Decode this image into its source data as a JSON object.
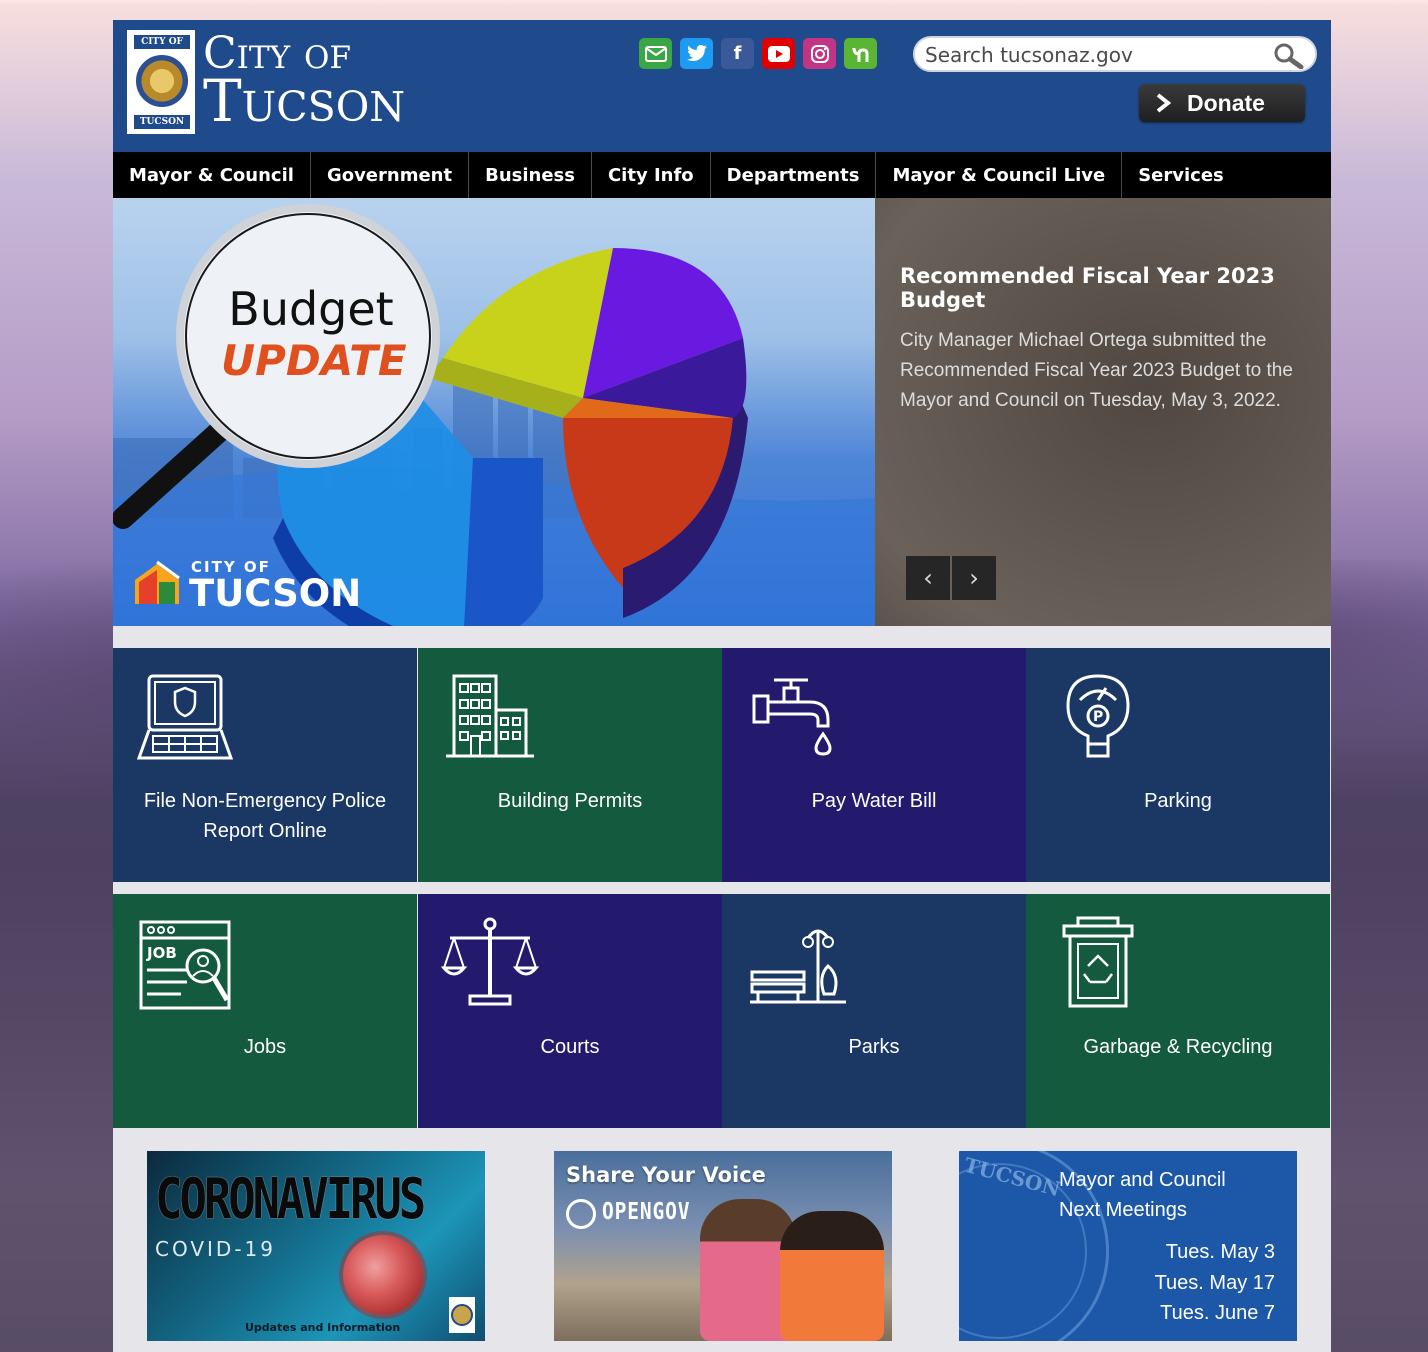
{
  "header": {
    "logo_top": "CITY OF",
    "logo_bottom": "TUCSON",
    "title_line1": "City of",
    "title_line2": "Tucson",
    "search_placeholder": "Search tucsonaz.gov",
    "donate_label": "Donate",
    "social": [
      {
        "name": "email-icon",
        "color": "#3aa646",
        "glyph": "✉"
      },
      {
        "name": "twitter-icon",
        "color": "#1d9bf0",
        "glyph": "🐦"
      },
      {
        "name": "facebook-icon",
        "color": "#3b5998",
        "glyph": "f"
      },
      {
        "name": "youtube-icon",
        "color": "#e00000",
        "glyph": "▶"
      },
      {
        "name": "instagram-icon",
        "color": "#c13584",
        "glyph": "◎"
      },
      {
        "name": "nextdoor-icon",
        "color": "#5bb535",
        "glyph": "n"
      }
    ]
  },
  "nav": {
    "items": [
      "Mayor & Council",
      "Government",
      "Business",
      "City Info",
      "Departments",
      "Mayor & Council Live",
      "Services"
    ]
  },
  "hero": {
    "budget_word": "Budget",
    "update_word": "UPDATE",
    "city_of": "CITY OF",
    "tucson": "TUCSON",
    "headline": "Recommended Fiscal Year 2023 Budget",
    "body": "City Manager Michael Ortega submitted the Recommended Fiscal Year 2023 Budget to the Mayor and Council on Tuesday, May 3, 2022.",
    "prev": "‹",
    "next": "›"
  },
  "tiles": [
    {
      "label": "File Non-Emergency Police Report Online",
      "color": "#1b3764",
      "icon": "laptop-police-icon"
    },
    {
      "label": "Building Permits",
      "color": "#135a3e",
      "icon": "building-icon"
    },
    {
      "label": "Pay Water Bill",
      "color": "#231a6e",
      "icon": "faucet-icon"
    },
    {
      "label": "Parking",
      "color": "#1b3764",
      "icon": "parking-meter-icon"
    },
    {
      "label": "Jobs",
      "color": "#135a3e",
      "icon": "job-search-icon"
    },
    {
      "label": "Courts",
      "color": "#231a6e",
      "icon": "scales-icon"
    },
    {
      "label": "Parks",
      "color": "#1b3764",
      "icon": "park-bench-icon"
    },
    {
      "label": "Garbage & Recycling",
      "color": "#135a3e",
      "icon": "recycling-bin-icon"
    }
  ],
  "cards": {
    "covid": {
      "title": "CORONAVIRUS",
      "subtitle": "COVID-19",
      "footer": "Updates and Information"
    },
    "share": {
      "title": "Share Your Voice",
      "brand": "OPENGOV"
    },
    "meetings": {
      "seal_text": "TUCSON",
      "heading_line1": "Mayor and Council",
      "heading_line2": "Next Meetings",
      "dates": [
        "Tues. May 3",
        "Tues. May 17",
        "Tues. June 7"
      ]
    }
  }
}
